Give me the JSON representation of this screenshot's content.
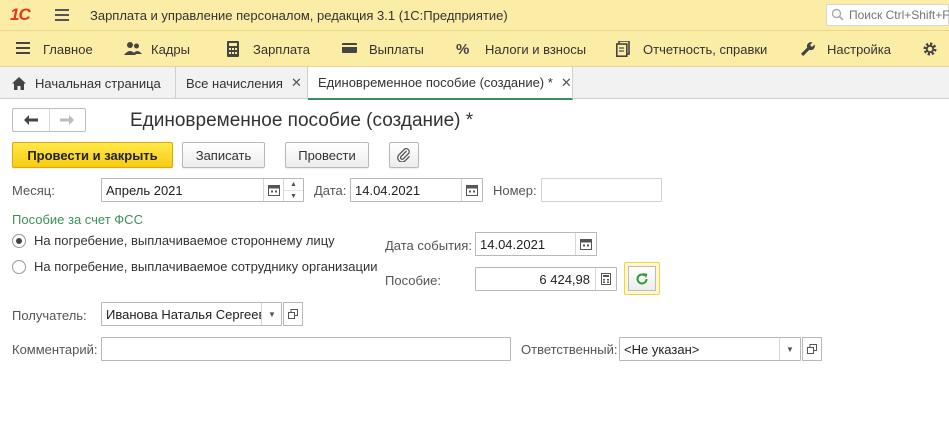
{
  "app": {
    "logo": "1С",
    "title": "Зарплата и управление персоналом, редакция 3.1  (1С:Предприятие)",
    "search_placeholder": "Поиск Ctrl+Shift+F"
  },
  "menu": [
    {
      "label": "Главное",
      "icon": "list-icon"
    },
    {
      "label": "Кадры",
      "icon": "people-icon"
    },
    {
      "label": "Зарплата",
      "icon": "calculator-icon"
    },
    {
      "label": "Выплаты",
      "icon": "wallet-icon"
    },
    {
      "label": "Налоги и взносы",
      "icon": "percent-icon"
    },
    {
      "label": "Отчетность, справки",
      "icon": "reports-icon"
    },
    {
      "label": "Настройка",
      "icon": "wrench-icon"
    }
  ],
  "tabs": [
    {
      "label": "Начальная страница",
      "icon": "home-icon",
      "closable": false,
      "active": false
    },
    {
      "label": "Все начисления",
      "closable": true,
      "active": false
    },
    {
      "label": "Единовременное пособие (создание) *",
      "closable": true,
      "active": true
    }
  ],
  "form": {
    "title": "Единовременное пособие (создание) *",
    "buttons": {
      "post_close": "Провести и закрыть",
      "save": "Записать",
      "post": "Провести"
    },
    "month": {
      "label": "Месяц:",
      "value": "Апрель 2021"
    },
    "date": {
      "label": "Дата:",
      "value": "14.04.2021"
    },
    "number": {
      "label": "Номер:",
      "value": ""
    },
    "fss_group": {
      "title": "Пособие за счет ФСС",
      "options": [
        {
          "label": "На погребение, выплачиваемое стороннему лицу",
          "selected": true
        },
        {
          "label": "На погребение, выплачиваемое сотруднику организации",
          "selected": false
        }
      ]
    },
    "event_date": {
      "label": "Дата события:",
      "value": "14.04.2021"
    },
    "benefit": {
      "label": "Пособие:",
      "value": "6 424,98"
    },
    "recipient": {
      "label": "Получатель:",
      "value": "Иванова Наталья Сергеевна"
    },
    "comment": {
      "label": "Комментарий:",
      "value": ""
    },
    "responsible": {
      "label": "Ответственный:",
      "value": "<Не указан>"
    }
  },
  "colors": {
    "header_bg": "#fbeda5",
    "primary_button": "#f7cc14",
    "accent_green": "#3b8f5b",
    "logo_red": "#e8351d"
  }
}
